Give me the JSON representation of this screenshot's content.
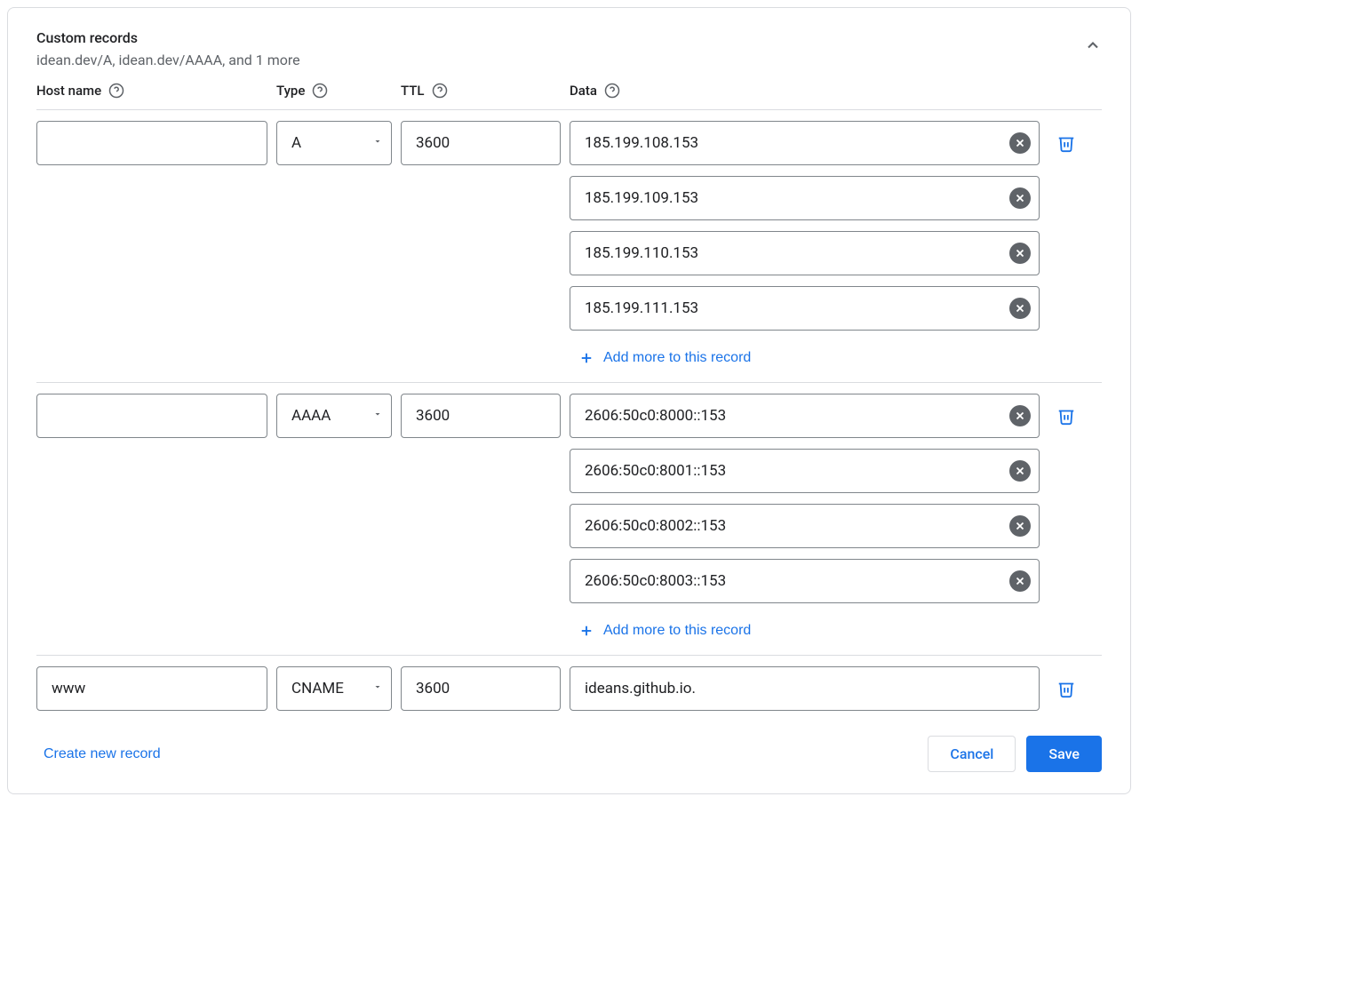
{
  "header": {
    "title": "Custom records",
    "subtitle": "idean.dev/A, idean.dev/AAAA, and 1 more"
  },
  "columns": {
    "hostname": "Host name",
    "type": "Type",
    "ttl": "TTL",
    "data": "Data"
  },
  "records": [
    {
      "hostname": "",
      "type": "A",
      "ttl": "3600",
      "data": [
        "185.199.108.153",
        "185.199.109.153",
        "185.199.110.153",
        "185.199.111.153"
      ],
      "showAddMore": true
    },
    {
      "hostname": "",
      "type": "AAAA",
      "ttl": "3600",
      "data": [
        "2606:50c0:8000::153",
        "2606:50c0:8001::153",
        "2606:50c0:8002::153",
        "2606:50c0:8003::153"
      ],
      "showAddMore": true
    },
    {
      "hostname": "www",
      "type": "CNAME",
      "ttl": "3600",
      "data": [
        "ideans.github.io."
      ],
      "showAddMore": false
    }
  ],
  "actions": {
    "addMore": "Add more to this record",
    "createNew": "Create new record",
    "cancel": "Cancel",
    "save": "Save"
  }
}
